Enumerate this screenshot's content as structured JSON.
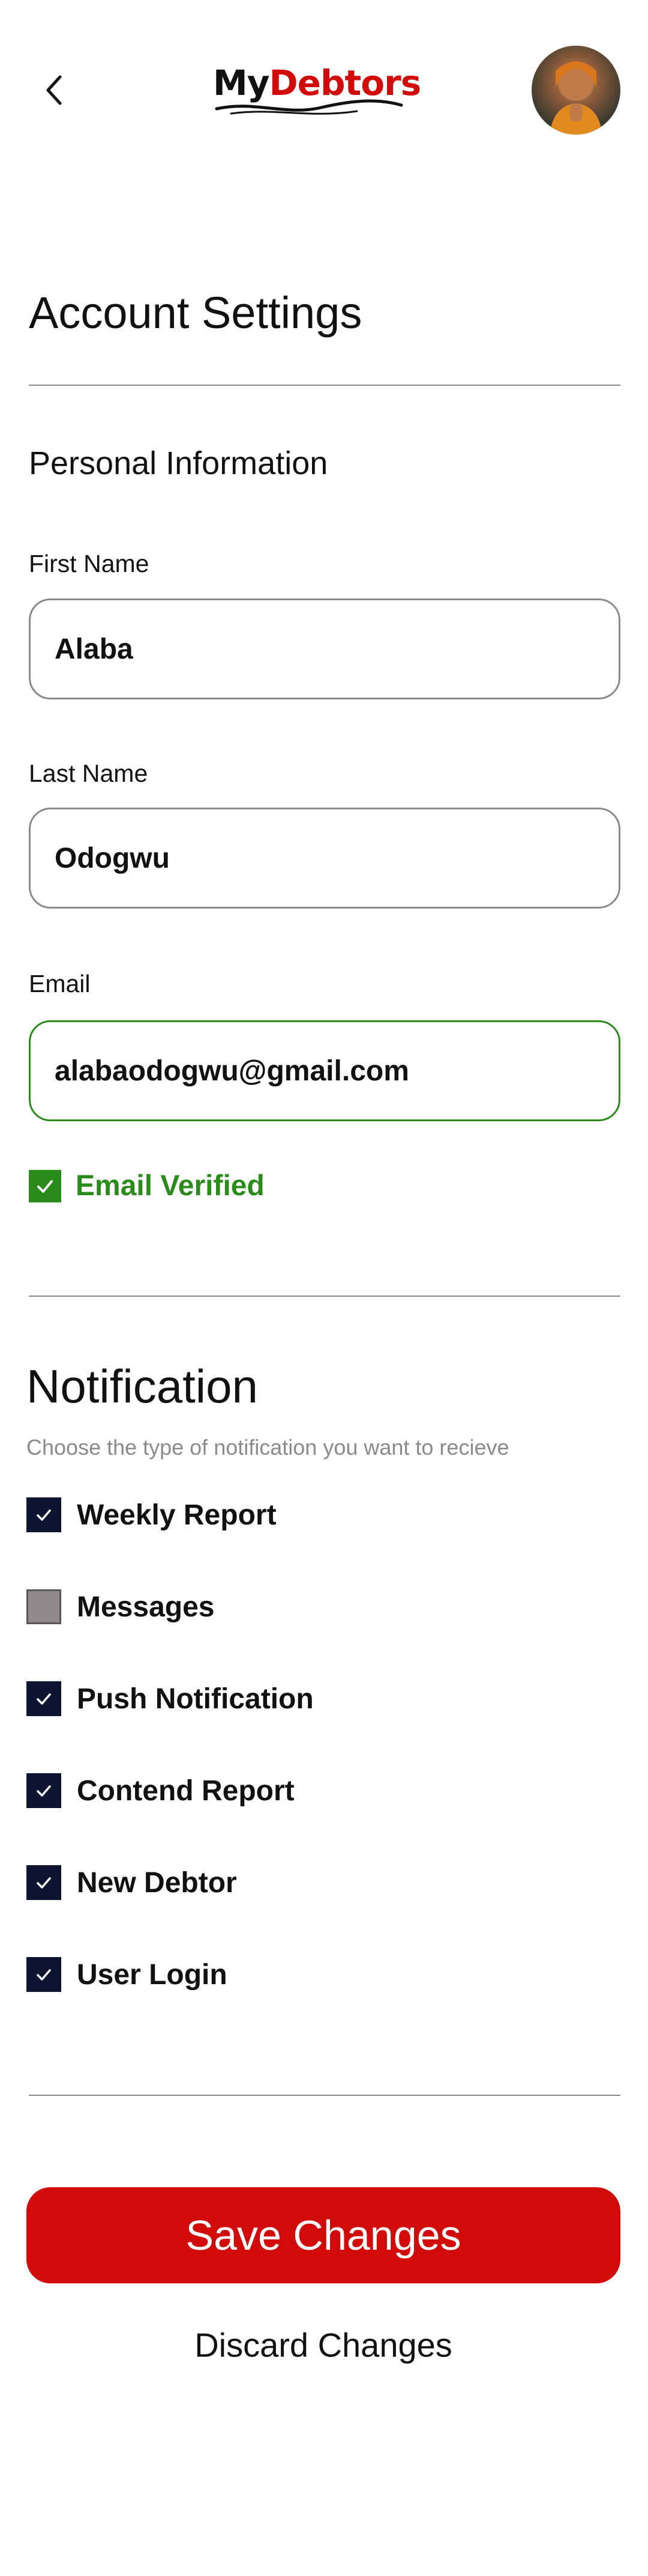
{
  "header": {
    "logo_prefix": "My",
    "logo_suffix": "Debtors",
    "back_icon": "chevron-left-icon",
    "avatar_icon": "user-avatar"
  },
  "page_title": "Account Settings",
  "personal_info": {
    "title": "Personal Information",
    "first_name": {
      "label": "First Name",
      "value": "Alaba"
    },
    "last_name": {
      "label": "Last Name",
      "value": "Odogwu"
    },
    "email": {
      "label": "Email",
      "value": "alabaodogwu@gmail.com"
    },
    "verified_text": "Email Verified"
  },
  "notification": {
    "title": "Notification",
    "subtitle": "Choose the type of notification you want to recieve",
    "items": [
      {
        "label": "Weekly Report",
        "checked": true
      },
      {
        "label": "Messages",
        "checked": false
      },
      {
        "label": "Push Notification",
        "checked": true
      },
      {
        "label": "Contend Report",
        "checked": true
      },
      {
        "label": "New Debtor",
        "checked": true
      },
      {
        "label": "User Login",
        "checked": true
      }
    ]
  },
  "actions": {
    "save_label": "Save Changes",
    "discard_label": "Discard Changes"
  },
  "colors": {
    "brand_red": "#d10a0a",
    "verified_green": "#2a8a1a",
    "checkbox_navy": "#0d1530",
    "checkbox_unchecked": "#8f8a8a"
  }
}
